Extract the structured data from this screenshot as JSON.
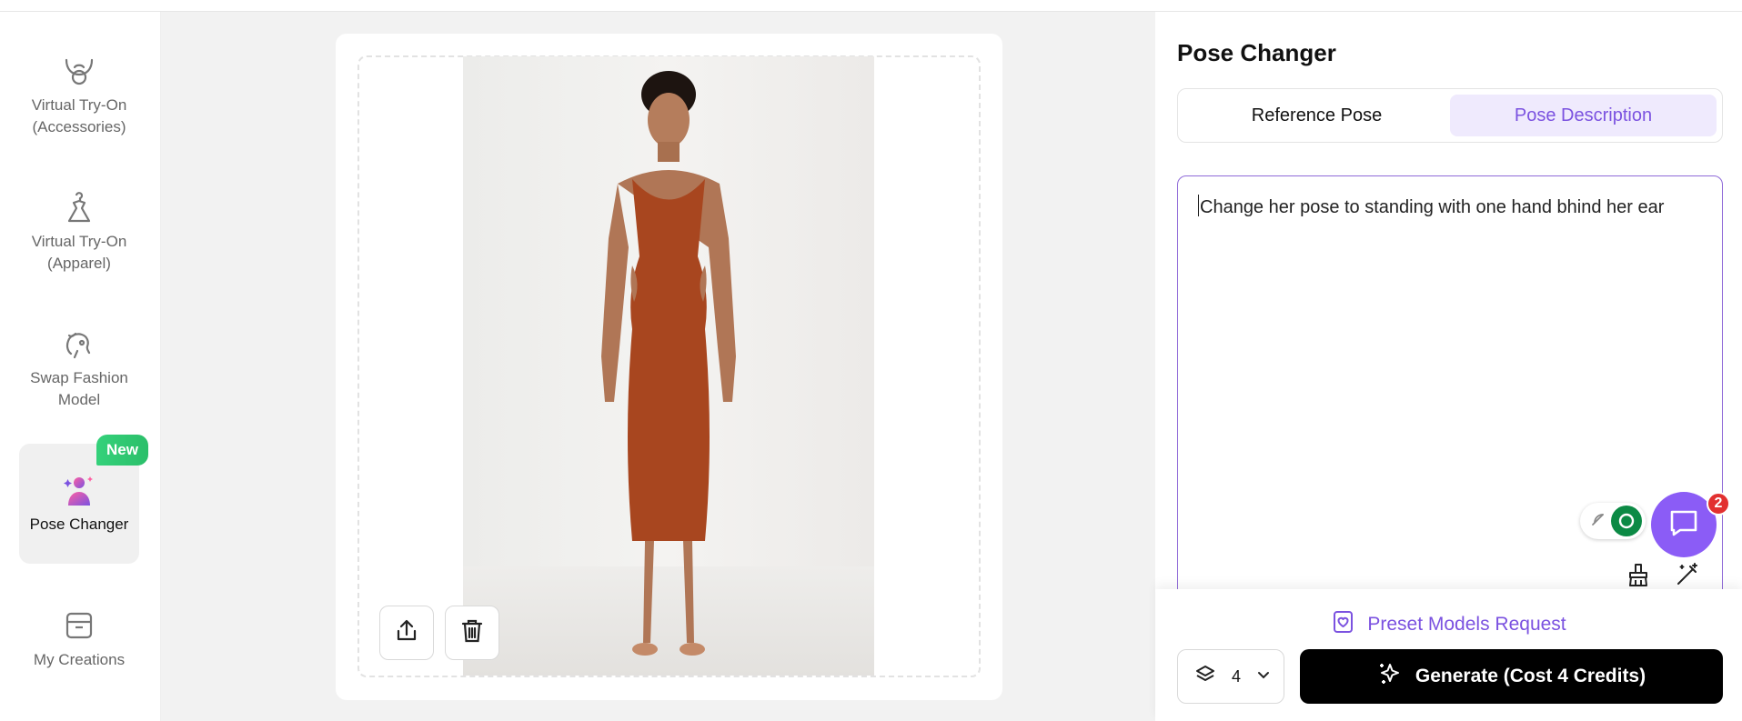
{
  "sidebar": {
    "items": [
      {
        "label": "Virtual Try-On (Accessories)",
        "icon": "necklace-icon"
      },
      {
        "label": "Virtual Try-On (Apparel)",
        "icon": "dress-hanger-icon"
      },
      {
        "label": "Swap Fashion Model",
        "icon": "face-swap-icon"
      },
      {
        "label": "Pose Changer",
        "icon": "pose-sparkle-icon",
        "badge": "New"
      },
      {
        "label": "My Creations",
        "icon": "archive-box-icon"
      }
    ]
  },
  "panel": {
    "title": "Pose Changer",
    "tabs": [
      {
        "label": "Reference Pose",
        "active": false
      },
      {
        "label": "Pose Description",
        "active": true
      }
    ],
    "prompt_value": "Change her pose to standing with one hand bhind her ear"
  },
  "chat": {
    "unread_count": "2"
  },
  "footer": {
    "preset_label": "Preset Models Request",
    "image_count": "4",
    "generate_label": "Generate (Cost 4 Credits)"
  },
  "colors": {
    "accent": "#7b52e0",
    "tab_active_bg": "#efeafd",
    "chat_bubble": "#8b5cf6",
    "badge_new": "#34d17a",
    "dress": "#a8461f"
  }
}
